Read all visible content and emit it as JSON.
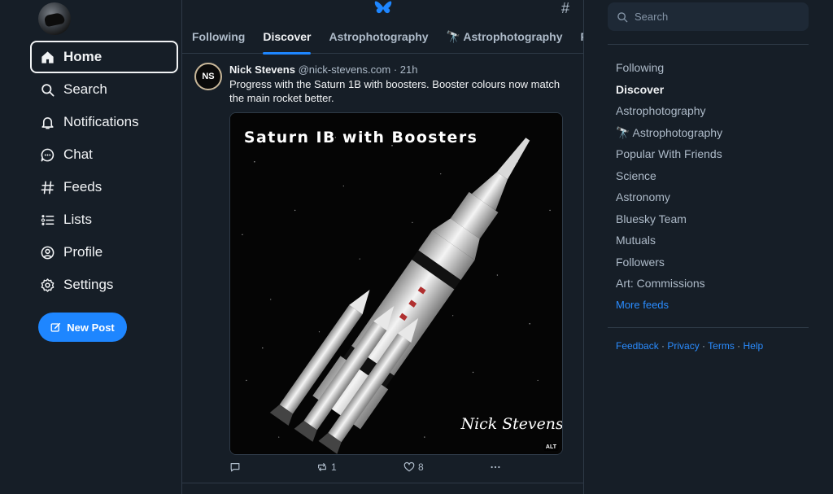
{
  "nav": {
    "items": [
      {
        "label": "Home",
        "icon": "home-icon"
      },
      {
        "label": "Search",
        "icon": "search-icon"
      },
      {
        "label": "Notifications",
        "icon": "bell-icon"
      },
      {
        "label": "Chat",
        "icon": "chat-icon"
      },
      {
        "label": "Feeds",
        "icon": "hash-icon"
      },
      {
        "label": "Lists",
        "icon": "list-icon"
      },
      {
        "label": "Profile",
        "icon": "profile-icon"
      },
      {
        "label": "Settings",
        "icon": "gear-icon"
      }
    ],
    "new_post_label": "New Post"
  },
  "header": {
    "tabs": [
      "Following",
      "Discover",
      "Astrophotography",
      "🔭 Astrophotography",
      "Pop"
    ],
    "active_tab": "Discover"
  },
  "post": {
    "avatar_initials": "NS",
    "author_name": "Nick Stevens",
    "author_handle": "@nick-stevens.com",
    "time": "· 21h",
    "text": "Progress with the Saturn 1B with boosters. Booster colours now match the main rocket better.",
    "image_title": "Saturn IB with Boosters",
    "image_signature": "Nick Stevens",
    "alt_badge": "ALT",
    "reposts": "1",
    "likes": "8"
  },
  "sidebar": {
    "search_placeholder": "Search",
    "feeds": [
      "Following",
      "Discover",
      "Astrophotography",
      "🔭 Astrophotography",
      "Popular With Friends",
      "Science",
      "Astronomy",
      "Bluesky Team",
      "Mutuals",
      "Followers",
      "Art: Commissions"
    ],
    "active_feed": "Discover",
    "more_feeds": "More feeds",
    "footer": [
      "Feedback",
      "Privacy",
      "Terms",
      "Help"
    ]
  },
  "colors": {
    "background": "#161e27",
    "accent": "#1e86ff",
    "link": "#2a8cff",
    "muted_text": "#aebbc9"
  }
}
